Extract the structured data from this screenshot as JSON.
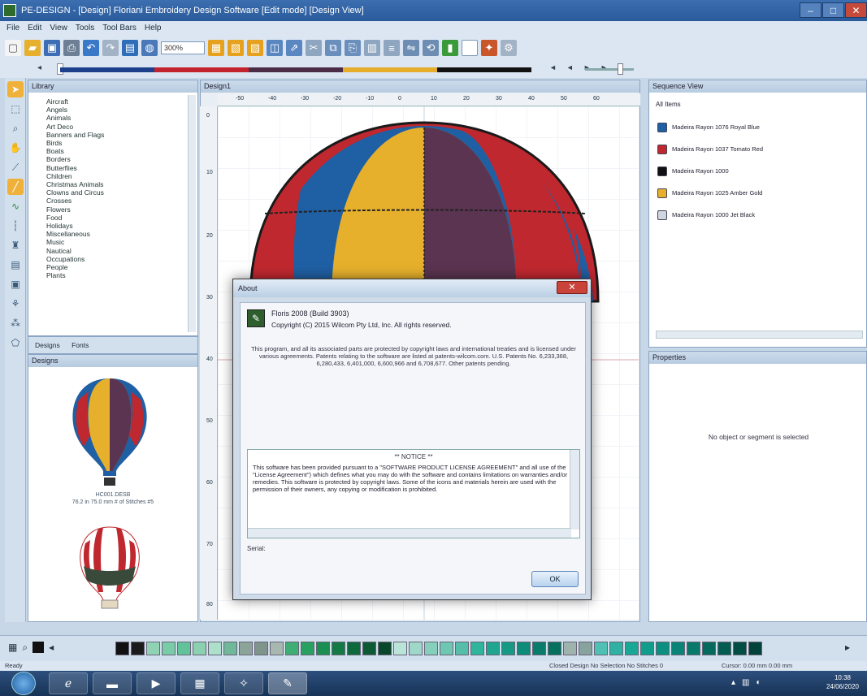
{
  "window": {
    "title": "PE-DESIGN - [Design] Floriani Embroidery Design Software [Edit mode] [Design View]",
    "minimize_label": "–",
    "maximize_label": "□",
    "close_label": "✕"
  },
  "menu": [
    "File",
    "Edit",
    "View",
    "Tools",
    "Tool Bars",
    "Help"
  ],
  "toolbar": {
    "zoom_value": "300%",
    "page_nav": [
      "◄",
      "◄",
      "►",
      "►"
    ]
  },
  "colors": {
    "strip": [
      "#1c3f8c",
      "#c3232c",
      "#4c2d48",
      "#e5ad2a",
      "#111111"
    ],
    "balloon_red": "#c0282f",
    "balloon_blue": "#1f5fa3",
    "balloon_yellow": "#e6b02c",
    "balloon_plum": "#5a3450",
    "threads": [
      "#111111",
      "#1b1b1b",
      "#8fd3b4",
      "#7acca8",
      "#62c39a",
      "#8bd1b0",
      "#aedfca",
      "#6fb89a",
      "#8ca39a",
      "#7f958c",
      "#a8b8b1",
      "#3fae74",
      "#27a060",
      "#1b8f52",
      "#137a45",
      "#0e6a3c",
      "#0c5a33",
      "#08472a",
      "#b9e4d7",
      "#9fd8c9",
      "#86cfbd",
      "#6fc7b3",
      "#55bea8",
      "#2fb59c",
      "#20a690",
      "#169a86",
      "#0e8c7a",
      "#0a7c6c",
      "#06705f",
      "#9fb3ae",
      "#88a39d",
      "#4fc0b3",
      "#2fb2a3",
      "#1aa896",
      "#109d8c",
      "#0b8f80",
      "#0a8476",
      "#08786b",
      "#056a5e",
      "#035c51",
      "#024e44",
      "#01433a"
    ]
  },
  "library": {
    "title": "Library",
    "items": [
      "Aircraft",
      "Angels",
      "Animals",
      "Art Deco",
      "Banners and Flags",
      "Birds",
      "Boats",
      "Borders",
      "Butterflies",
      "Children",
      "Christmas Animals",
      "Clowns and Circus",
      "Crosses",
      "Flowers",
      "Food",
      "Holidays",
      "Miscellaneous",
      "Music",
      "Nautical",
      "Occupations",
      "People",
      "Plants"
    ],
    "tabs": [
      "Designs",
      "Fonts"
    ]
  },
  "designs": {
    "title": "Designs",
    "items": [
      {
        "name": "HC001.DESB",
        "size": "76.2 in  75.0 mm  # of Stitches  #5"
      }
    ]
  },
  "canvas_tab": "Design1",
  "ruler_h": [
    "-50",
    "-40",
    "-30",
    "-20",
    "-10",
    "0",
    "10",
    "20",
    "30",
    "40",
    "50",
    "60"
  ],
  "ruler_v": [
    "0",
    "10",
    "20",
    "30",
    "40",
    "50",
    "60",
    "70",
    "80"
  ],
  "sequence_view": {
    "title": "Sequence View",
    "root": "All Items",
    "items": [
      {
        "label": "Madeira Rayon 1076 Royal Blue",
        "color": "#1f5fa3"
      },
      {
        "label": "Madeira Rayon 1037 Tomato Red",
        "color": "#c0282f"
      },
      {
        "label": "Madeira Rayon 1000",
        "color": "#111111"
      },
      {
        "label": "Madeira Rayon 1025 Amber Gold",
        "color": "#e6b02c"
      },
      {
        "label": "Madeira Rayon 1000 Jet Black",
        "color": "#cfd6de"
      }
    ]
  },
  "properties": {
    "title": "Properties",
    "message": "No object or segment is selected"
  },
  "dialog": {
    "title": "About",
    "product": "Floris 2008 (Build 3903)",
    "copyright": "Copyright (C) 2015 Wilcom Pty Ltd, Inc. All rights reserved.",
    "notice": "This program, and all its associated parts are protected by copyright laws and international treaties and is licensed under various agreements. Patents relating to the software are listed at patents-wilcom.com. U.S. Patents No. 6,233,368, 6,280,433, 6,401,000, 6,600,966 and 6,708,677. Other patents pending.",
    "license_heading": "** NOTICE **",
    "license_text": "This software has been provided pursuant to a \"SOFTWARE PRODUCT LICENSE AGREEMENT\" and all use of the \"License Agreement\") which defines what you may do with the software and contains limitations on warranties and/or remedies. This software is protected by copyright laws. Some of the icons and materials herein are used with the permission of their owners, any copying or modification is prohibited.",
    "serial_label": "Serial:",
    "ok_label": "OK"
  },
  "status": {
    "left": "Ready",
    "middle": "Closed Design  No Selection  No Stitches  0",
    "right": "Cursor: 0.00 mm  0.00 mm"
  },
  "taskbar": {
    "clock_time": "10:38",
    "clock_date": "24/06/2020"
  }
}
